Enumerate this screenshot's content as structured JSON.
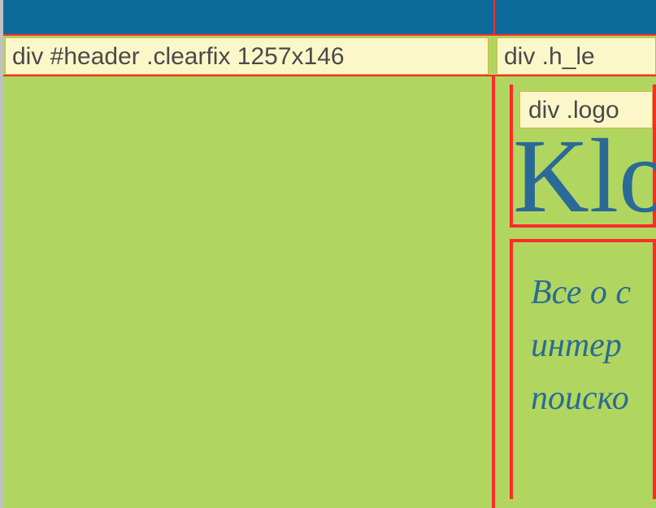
{
  "labels": {
    "header": "div #header .clearfix 1257x146",
    "h_left": "div .h_le",
    "logo": "div .logo"
  },
  "logo_text": "Klo",
  "description": {
    "line1": "Все о с",
    "line2": "интер",
    "line3": "поиско"
  }
}
